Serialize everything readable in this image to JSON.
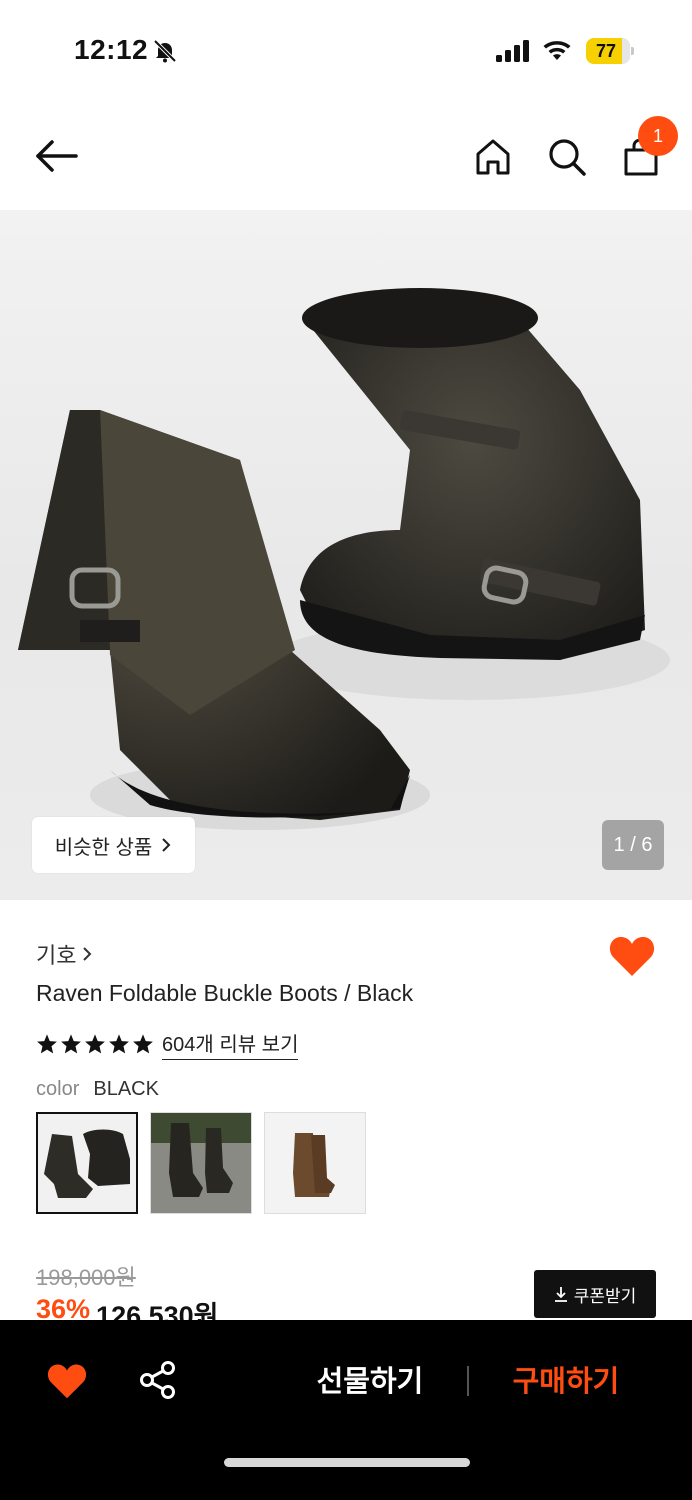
{
  "status_bar": {
    "time": "12:12",
    "battery": "77"
  },
  "nav": {
    "cart_badge": "1"
  },
  "gallery": {
    "similar_label": "비슷한 상품",
    "page_indicator": "1 / 6"
  },
  "product": {
    "brand": "기호",
    "title": "Raven Foldable Buckle Boots / Black",
    "rating": 5,
    "review_link": "604개 리뷰 보기",
    "color_label": "color",
    "color_value": "BLACK",
    "swatches": [
      {
        "name": "black-folded",
        "selected": true
      },
      {
        "name": "black-worn",
        "selected": false
      },
      {
        "name": "brown",
        "selected": false
      }
    ],
    "original_price": "198,000원",
    "discount": "36%",
    "sale_price": "126,530원",
    "coupon_label": "쿠폰받기"
  },
  "bottom_bar": {
    "gift_label": "선물하기",
    "buy_label": "구매하기"
  },
  "colors": {
    "accent": "#ff4d12",
    "bottom_bar_bg": "#000000"
  }
}
